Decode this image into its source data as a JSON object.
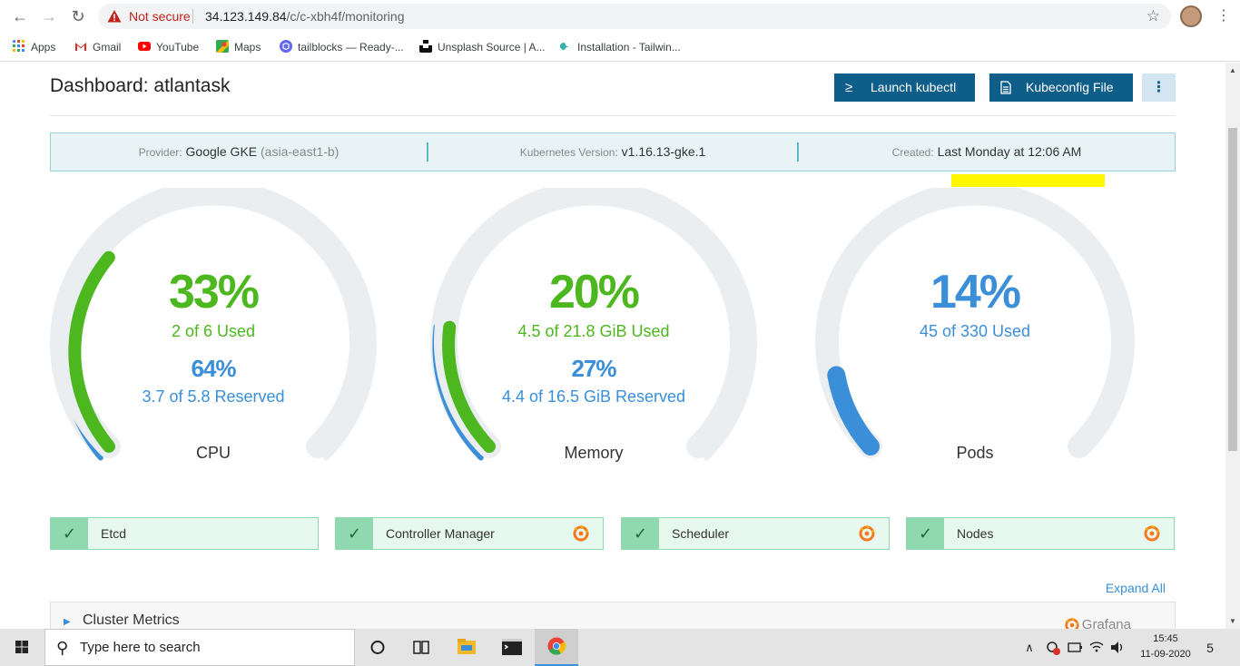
{
  "browser": {
    "security_label": "Not secure",
    "url_host": "34.123.149.84",
    "url_path": "/c/c-xbh4f/monitoring",
    "bookmarks": [
      {
        "label": "Apps",
        "icon": "apps-grid-icon",
        "color": "#4285f4"
      },
      {
        "label": "Gmail",
        "icon": "gmail-icon",
        "color": "#d93025"
      },
      {
        "label": "YouTube",
        "icon": "youtube-icon",
        "color": "#ff0000"
      },
      {
        "label": "Maps",
        "icon": "maps-icon",
        "color": "#34a853"
      },
      {
        "label": "tailblocks — Ready-...",
        "icon": "tailblocks-icon",
        "color": "#6366f1"
      },
      {
        "label": "Unsplash Source | A...",
        "icon": "unsplash-icon",
        "color": "#111111"
      },
      {
        "label": "Installation - Tailwin...",
        "icon": "tailwind-icon",
        "color": "#38b2ac"
      }
    ]
  },
  "dashboard": {
    "title": "Dashboard: atlantask",
    "launch_kubectl": "Launch kubectl",
    "kubeconfig_file": "Kubeconfig File",
    "provider_label": "Provider:",
    "provider_value": "Google GKE",
    "provider_zone": "(asia-east1-b)",
    "k8s_label": "Kubernetes Version:",
    "k8s_value": "v1.16.13-gke.1",
    "created_label": "Created:",
    "created_value": "Last Monday at 12:06 AM"
  },
  "gauges": [
    {
      "label": "CPU",
      "used_pct": "33%",
      "used_text": "2 of 6 Used",
      "reserved_pct": "64%",
      "reserved_text": "3.7 of 5.8 Reserved",
      "used_fraction": 0.33,
      "reserved_fraction": 0.64
    },
    {
      "label": "Memory",
      "used_pct": "20%",
      "used_text": "4.5 of 21.8 GiB Used",
      "reserved_pct": "27%",
      "reserved_text": "4.4 of 16.5 GiB Reserved",
      "used_fraction": 0.2,
      "reserved_fraction": 0.27
    },
    {
      "label": "Pods",
      "used_pct": "14%",
      "used_text": "45 of 330 Used",
      "used_fraction": 0.14
    }
  ],
  "status_cards": [
    {
      "label": "Etcd",
      "grafana": false
    },
    {
      "label": "Controller Manager",
      "grafana": true
    },
    {
      "label": "Scheduler",
      "grafana": true
    },
    {
      "label": "Nodes",
      "grafana": true
    }
  ],
  "expand_all": "Expand All",
  "cluster_metrics": {
    "title": "Cluster Metrics",
    "grafana": "Grafana"
  },
  "taskbar": {
    "search_placeholder": "Type here to search",
    "time": "15:45",
    "date": "11-09-2020",
    "notification_count": "5"
  },
  "colors": {
    "green": "#4cb71f",
    "blue": "#3a8fd8",
    "track": "#ebeef0",
    "brand": "#0f5e8a"
  }
}
